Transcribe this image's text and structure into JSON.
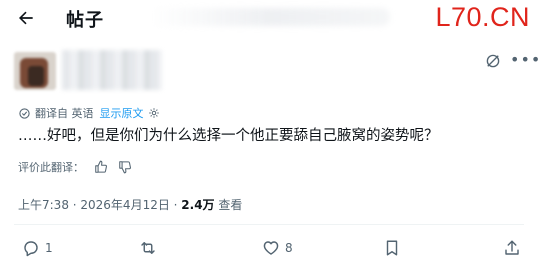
{
  "header": {
    "title": "帖子",
    "back_icon": "arrow-left-icon",
    "watermark": "L70.CN",
    "watermark_color": "#e0241b"
  },
  "author": {
    "avatar": "avatar",
    "name_redacted": true,
    "grok_icon": "grok-icon",
    "more_icon": "more-dots-icon",
    "more_label": "•••"
  },
  "translation": {
    "label": "翻译自 英语",
    "show_original": "显示原文",
    "settings_icon": "gear-icon"
  },
  "post": {
    "text": "……好吧，但是你们为什么选择一个他正要舔自己腋窝的姿势呢？"
  },
  "rate": {
    "label": "评价此翻译：",
    "up_icon": "thumbs-up-icon",
    "down_icon": "thumbs-down-icon"
  },
  "meta": {
    "time_date": "上午7:38 · 2026年4月12日 · ",
    "views_count": "2.4万",
    "views_label": " 查看"
  },
  "actions": {
    "reply_count": "1",
    "repost_count": "",
    "like_count": "8",
    "accent_color": "#536471"
  }
}
